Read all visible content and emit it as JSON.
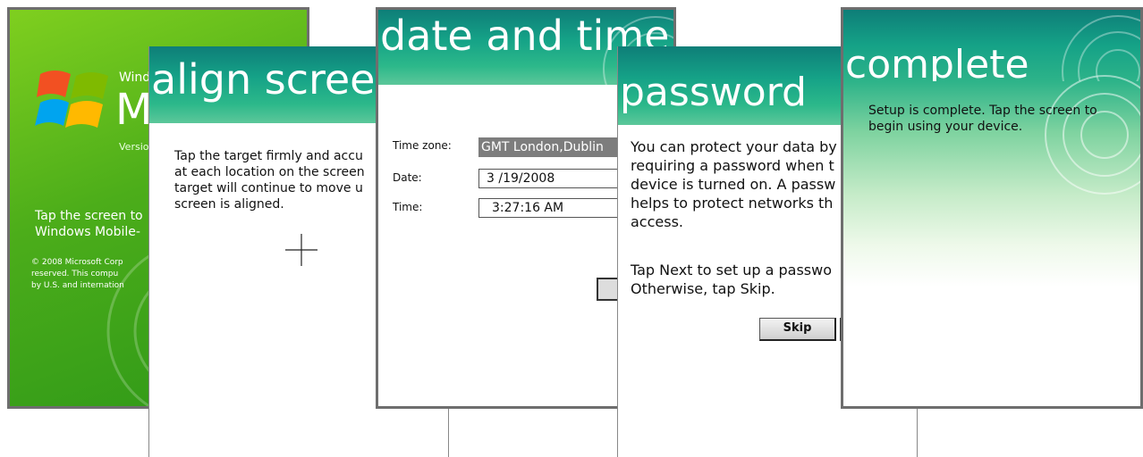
{
  "welcome": {
    "brand": "Windows",
    "product": "Mobile",
    "version": "Version",
    "tap_lines": [
      "Tap the screen to",
      "Windows Mobile-"
    ],
    "copyright_lines": [
      "© 2008 Microsoft Corp",
      "reserved.  This compu",
      "by U.S. and internation"
    ]
  },
  "align": {
    "title": "align screen",
    "instruction_lines": [
      "Tap the target firmly and accu",
      "at each location on the screen",
      "target will continue to move u",
      "screen is aligned."
    ]
  },
  "datetime": {
    "title": "date and time",
    "fields": [
      {
        "label": "Time zone:",
        "value": "GMT London,Dublin"
      },
      {
        "label": "Date:",
        "value": "3 /19/2008"
      },
      {
        "label": "Time:",
        "value": "3:27:16 AM"
      }
    ]
  },
  "password": {
    "title": "password",
    "para1_lines": [
      "You can protect your data by",
      "requiring a password when t",
      "device is turned on. A passw",
      "helps to protect networks th",
      "access."
    ],
    "para2_lines": [
      "Tap Next to set up a passwo",
      "Otherwise, tap Skip."
    ],
    "skip_label": "Skip"
  },
  "complete": {
    "title": "complete",
    "message_lines": [
      "Setup is complete. Tap the screen to",
      "begin using your device."
    ]
  },
  "colors": {
    "header_teal": "#15a287",
    "welcome_green": "#4cad1a",
    "frame_gray": "#6e6e6e"
  }
}
